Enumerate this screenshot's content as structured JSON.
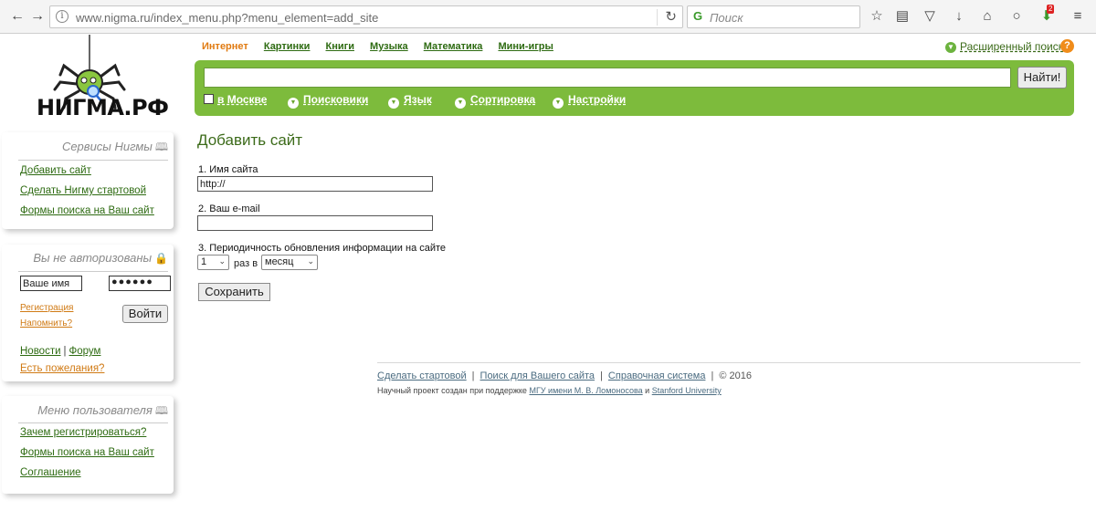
{
  "browser": {
    "url": "www.nigma.ru/index_menu.php?menu_element=add_site",
    "search_placeholder": "Поиск",
    "badge_count": "2"
  },
  "logo": {
    "text": "НИГМА.РФ"
  },
  "topnav": {
    "items": [
      {
        "label": "Интернет",
        "active": true
      },
      {
        "label": "Картинки"
      },
      {
        "label": "Книги"
      },
      {
        "label": "Музыка"
      },
      {
        "label": "Математика"
      },
      {
        "label": "Мини-игры"
      }
    ],
    "advanced_search": "Расширенный поиск"
  },
  "search": {
    "query": "",
    "button": "Найти!",
    "options": [
      {
        "label": "в Москве",
        "type": "checkbox"
      },
      {
        "label": "Поисковики",
        "type": "dropdown"
      },
      {
        "label": "Язык",
        "type": "dropdown"
      },
      {
        "label": "Сортировка",
        "type": "dropdown"
      },
      {
        "label": "Настройки",
        "type": "dropdown"
      }
    ]
  },
  "sidebar": {
    "services": {
      "title": "Сервисы Нигмы",
      "links": [
        "Добавить сайт",
        "Сделать Нигму стартовой",
        "Формы поиска на Ваш сайт"
      ]
    },
    "login": {
      "title": "Вы не авторизованы",
      "name_value": "Ваше имя",
      "password_value": "●●●●●●",
      "register": "Регистрация",
      "remind": "Напомнить?",
      "login_button": "Войти",
      "news": "Новости",
      "forum": "Форум",
      "wishes": "Есть пожелания?"
    },
    "user_menu": {
      "title": "Меню пользователя",
      "links": [
        "Зачем регистрироваться?",
        "Формы поиска на Ваш сайт",
        "Соглашение"
      ]
    }
  },
  "form": {
    "title": "Добавить сайт",
    "site_name_label": "1. Имя сайта",
    "site_name_value": "http://",
    "email_label": "2. Ваш e-mail",
    "email_value": "",
    "frequency_label": "3. Периодичность обновления информации на сайте",
    "frequency_count": "1",
    "frequency_text": "раз в",
    "frequency_period": "месяц",
    "save_button": "Сохранить"
  },
  "footer": {
    "links": [
      "Сделать стартовой",
      "Поиск для Вашего сайта",
      "Справочная система"
    ],
    "copyright": "© 2016",
    "project_text": "Научный проект создан при поддержке",
    "msu_link": "МГУ имени М. В. Ломоносова",
    "and": "и",
    "stanford_link": "Stanford University"
  }
}
